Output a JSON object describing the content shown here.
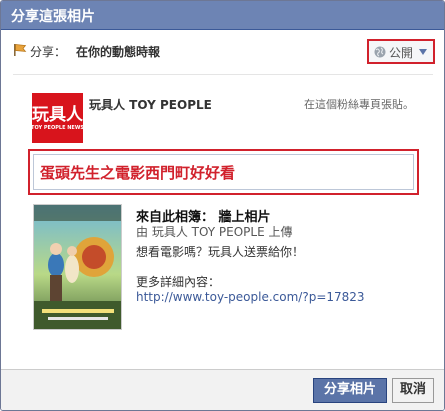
{
  "dialog": {
    "title": "分享這張相片"
  },
  "share": {
    "label": "分享：",
    "target": "在你的動態時報",
    "privacy": "公開"
  },
  "page": {
    "name": "玩具人 TOY PEOPLE",
    "location": "在這個粉絲專頁張貼。",
    "logo_text": "玩具人",
    "logo_subtext": "TOY PEOPLE NEWS"
  },
  "message": {
    "text": "蛋頭先生之電影西門町好好看"
  },
  "attachment": {
    "album_line": "來自此相簿：  牆上相片",
    "uploader": "由 玩具人 TOY PEOPLE 上傳",
    "description": "想看電影嗎？玩具人送票給你！",
    "more_label": "更多詳細內容：",
    "link": "http://www.toy-people.com/?p=17823"
  },
  "buttons": {
    "share": "分享相片",
    "cancel": "取消"
  },
  "colors": {
    "title_bar": "#6d84b4",
    "highlight": "#d1212c",
    "link": "#3b5998"
  }
}
